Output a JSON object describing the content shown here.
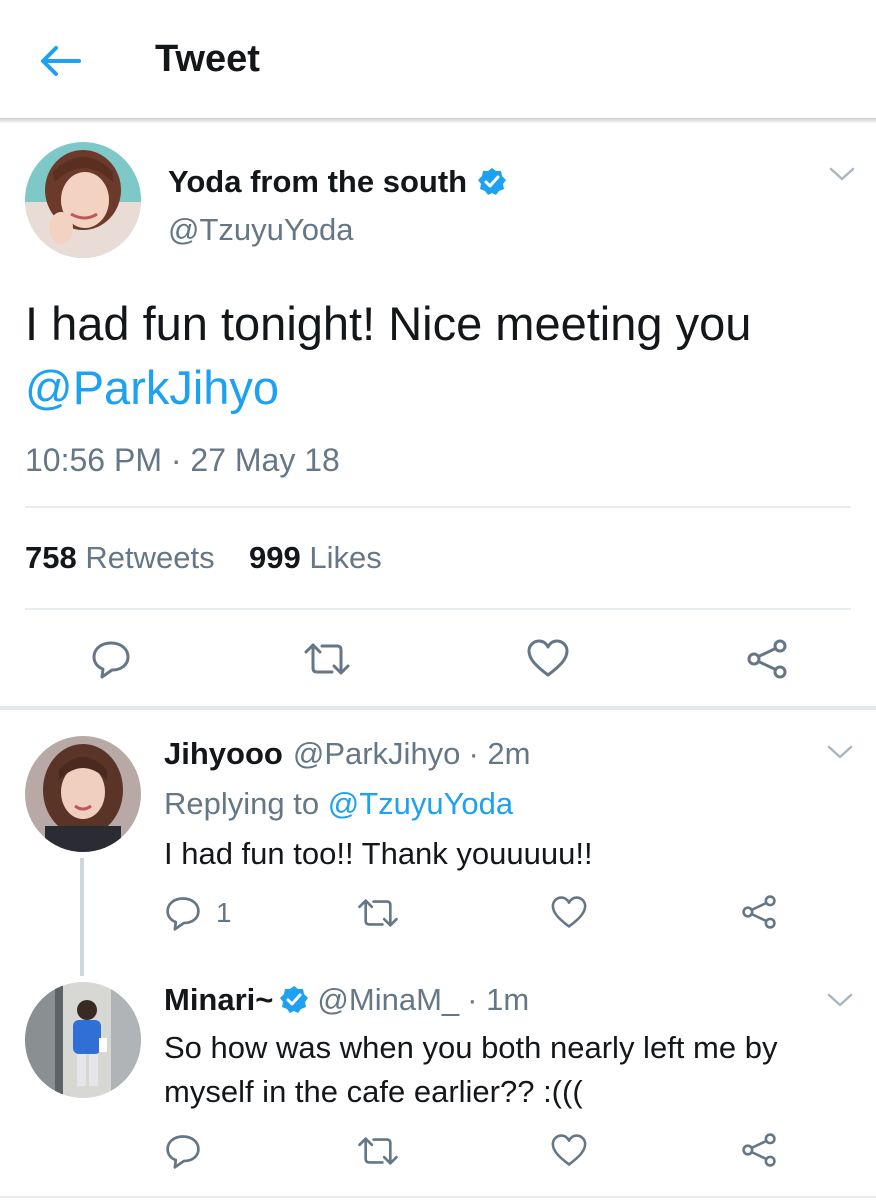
{
  "header": {
    "title": "Tweet",
    "back_icon": "arrow-left-icon"
  },
  "colors": {
    "accent": "#1da1f2",
    "secondary_text": "#657786",
    "primary_text": "#14171a",
    "divider": "#e6ecf0"
  },
  "main_tweet": {
    "display_name": "Yoda from the south",
    "verified": true,
    "handle": "@TzuyuYoda",
    "text": "I had fun tonight! Nice meeting you ",
    "mention": "@ParkJihyo",
    "timestamp": "10:56 PM · 27 May 18",
    "stats": {
      "retweets_count": "758",
      "retweets_label": "Retweets",
      "likes_count": "999",
      "likes_label": "Likes"
    }
  },
  "replies": [
    {
      "display_name": "Jihyooo",
      "handle": "@ParkJihyo",
      "time": "· 2m",
      "replying_label": "Replying to",
      "replying_to": "@TzuyuYoda",
      "text": "I had fun too!! Thank youuuuu!!",
      "reply_count": "1"
    },
    {
      "display_name": "Minari~",
      "verified": true,
      "handle": "@MinaM_",
      "time": "· 1m",
      "text_line1": "So how was when you both nearly left me by",
      "text_line2": "myself in the cafe earlier?? :((("
    }
  ]
}
